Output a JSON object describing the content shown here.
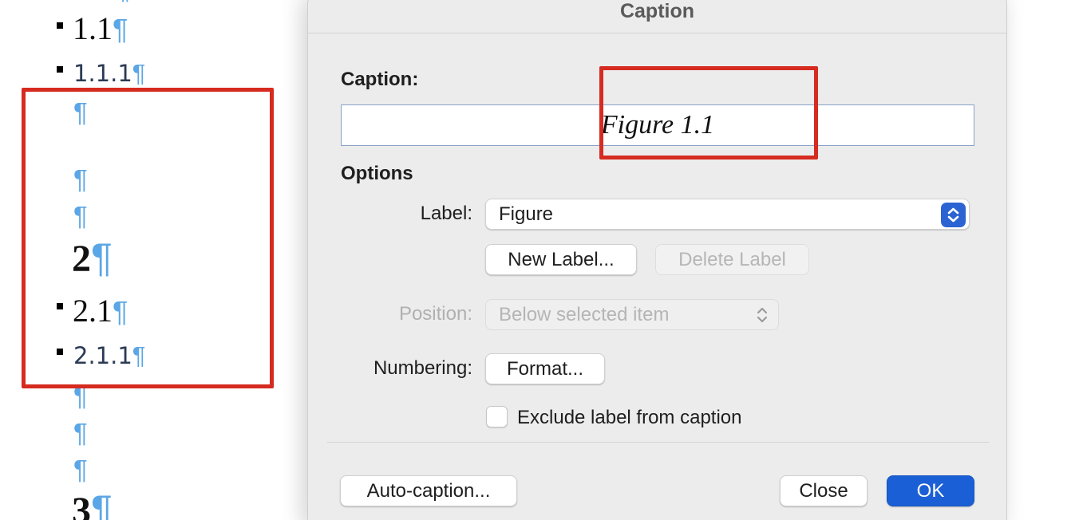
{
  "document": {
    "lines": [
      {
        "text": "1.1",
        "mark": "¶"
      },
      {
        "text": "1.1.1",
        "mark": "¶"
      },
      {
        "text": "",
        "mark": "¶"
      },
      {
        "text": "",
        "mark": "¶"
      },
      {
        "text": "",
        "mark": "¶"
      },
      {
        "text": "2",
        "mark": "¶"
      },
      {
        "text": "2.1",
        "mark": "¶"
      },
      {
        "text": "2.1.1",
        "mark": "¶"
      },
      {
        "text": "",
        "mark": "¶"
      },
      {
        "text": "",
        "mark": "¶"
      },
      {
        "text": "",
        "mark": "¶"
      },
      {
        "text": "3",
        "mark": "¶"
      }
    ]
  },
  "dialog": {
    "title": "Caption",
    "caption_label": "Caption:",
    "caption_value": "Figure 1.1",
    "options_heading": "Options",
    "label_label": "Label:",
    "label_value": "Figure",
    "new_label_button": "New Label...",
    "delete_label_button": "Delete Label",
    "position_label": "Position:",
    "position_value": "Below selected item",
    "numbering_label": "Numbering:",
    "format_button": "Format...",
    "exclude_label": "Exclude label from caption",
    "exclude_checked": false,
    "auto_caption_button": "Auto-caption...",
    "close_button": "Close",
    "ok_button": "OK"
  },
  "colors": {
    "annotation_red": "#d62b20",
    "pilcrow_blue": "#5aa6e6",
    "primary_blue": "#1b5fd6"
  }
}
